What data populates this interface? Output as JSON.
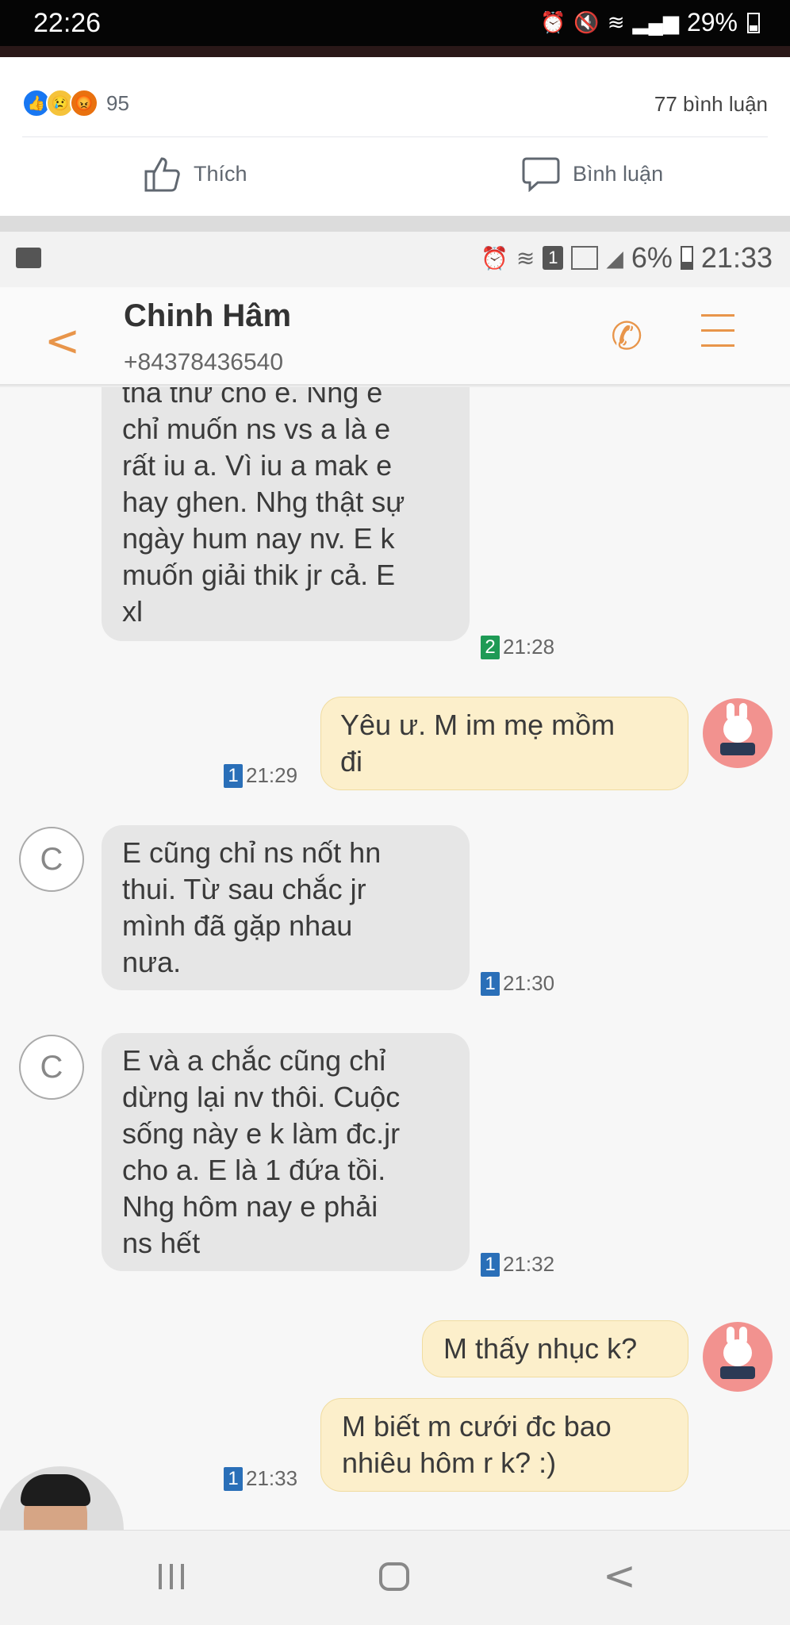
{
  "os_status": {
    "time": "22:26",
    "battery": "29%"
  },
  "facebook": {
    "reaction_count": "95",
    "comments": "77 bình luận",
    "like_label": "Thích",
    "comment_label": "Bình luận"
  },
  "inner_status": {
    "sim": "1",
    "battery": "6%",
    "time": "21:33"
  },
  "conversation": {
    "name": "Chinh Hâm",
    "number": "+84378436540"
  },
  "messages": [
    {
      "dir": "in",
      "lines": [
        "tha thứ cho e. Nhg e",
        "chỉ muốn ns vs a là e",
        "rất iu a. Vì iu a mak e",
        "hay ghen. Nhg thật sự",
        "ngày hum nay nv. E k",
        "muốn giải thik jr cả. E",
        "xl"
      ],
      "sim": "2",
      "time": "21:28"
    },
    {
      "dir": "out",
      "lines": [
        "Yêu ư. M im mẹ mồm",
        "đi"
      ],
      "sim": "1",
      "time": "21:29"
    },
    {
      "dir": "in",
      "avatar": "C",
      "lines": [
        "E cũng chỉ ns nốt hn",
        "thui. Từ sau chắc jr",
        "mình đã gặp nhau",
        "nưa."
      ],
      "sim": "1",
      "time": "21:30"
    },
    {
      "dir": "in",
      "avatar": "C",
      "lines": [
        "E và a chắc cũng chỉ",
        "dừng lại nv thôi. Cuộc",
        "sống này e k làm đc.jr",
        "cho a. E là 1 đứa tồi.",
        "Nhg hôm nay e phải",
        "ns hết"
      ],
      "sim": "1",
      "time": "21:32"
    },
    {
      "dir": "out",
      "lines": [
        "M thấy nhục k?"
      ]
    },
    {
      "dir": "out",
      "lines": [
        "M biết m cưới đc bao",
        "nhiêu hôm r k? :)"
      ],
      "sim": "1",
      "time": "21:33"
    }
  ],
  "colors": {
    "accent": "#e8954a",
    "outgoing_bubble": "#fcefcb",
    "incoming_bubble": "#e6e6e6",
    "fb_blue": "#1877f2"
  },
  "icons": [
    "alarm-icon",
    "mute-icon",
    "wifi-icon",
    "signal-icon",
    "battery-icon",
    "like-icon",
    "comment-icon",
    "back-icon",
    "call-icon",
    "menu-icon"
  ]
}
